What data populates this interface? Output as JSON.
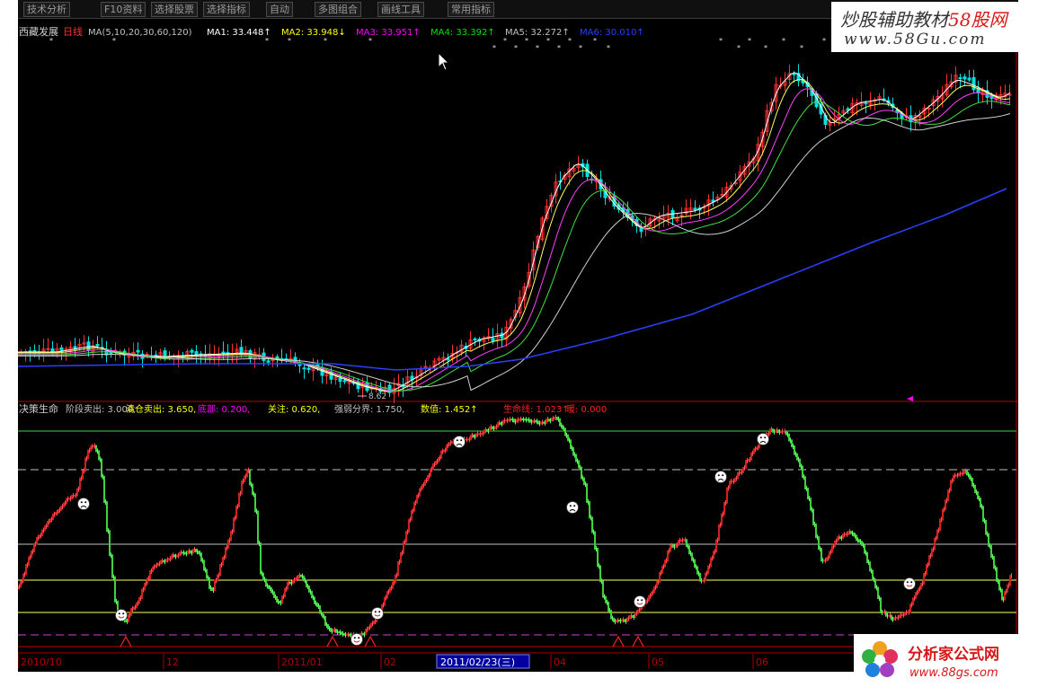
{
  "menu": [
    "技术分析",
    "F10资料",
    "选择股票",
    "选择指标",
    "自动",
    "多图组合",
    "画线工具",
    "常用指标"
  ],
  "main_chart": {
    "stock_name": "西藏发展",
    "period": "日线",
    "ma_params": "MA(5,10,20,30,60,120)",
    "ma": [
      {
        "label": "MA1:",
        "value": "33.448",
        "arrow": "↑",
        "color": "#ffffff"
      },
      {
        "label": "MA2:",
        "value": "33.948",
        "arrow": "↓",
        "color": "#ffff00"
      },
      {
        "label": "MA3:",
        "value": "33.951",
        "arrow": "↑",
        "color": "#ff00ff"
      },
      {
        "label": "MA4:",
        "value": "33.392",
        "arrow": "↑",
        "color": "#00e000"
      },
      {
        "label": "MA5:",
        "value": "32.272",
        "arrow": "↑",
        "color": "#c0c0c0"
      },
      {
        "label": "MA6:",
        "value": "30.010",
        "arrow": "↑",
        "color": "#2040ff"
      }
    ],
    "low_marker": "8.62"
  },
  "indicator": {
    "name": "决策生命",
    "items": [
      {
        "label": "阶段卖出:",
        "value": "3.000,",
        "color": "#c0c0c0"
      },
      {
        "label": "清仓卖出:",
        "value": "3.650,",
        "color": "#ffff00"
      },
      {
        "label": "底部:",
        "value": "0.200,",
        "color": "#ff00ff"
      },
      {
        "label": "关注:",
        "value": "0.620,",
        "color": "#ffff00"
      },
      {
        "label": "强弱分界:",
        "value": "1.750,",
        "color": "#c0c0c0"
      },
      {
        "label": "数值:",
        "value": "1.452",
        "color": "#ffff00",
        "arrow": "↑"
      },
      {
        "label": "生命线:",
        "value": "1.023",
        "color": "#ff2020",
        "arrow": "↑"
      },
      {
        "label": "暖:",
        "value": "0.000",
        "color": "#ff2020"
      }
    ]
  },
  "date_axis": {
    "labels": [
      "2010/10",
      "12",
      "2011/01",
      "02",
      "04",
      "05",
      "06"
    ],
    "cursor_date": "2011/02/23(三)"
  },
  "watermarks": {
    "top_title_a": "炒股辅助教材",
    "top_title_b": "58股网",
    "top_url": "www.58Gu.com",
    "bottom_title": "分析家公式网",
    "bottom_url": "www.88gs.com"
  },
  "colors": {
    "up_candle": "#ff3030",
    "down_candle": "#00e0e0",
    "indicator_up": "#d02020",
    "indicator_down": "#40d040",
    "axis_red": "#b00000"
  }
}
